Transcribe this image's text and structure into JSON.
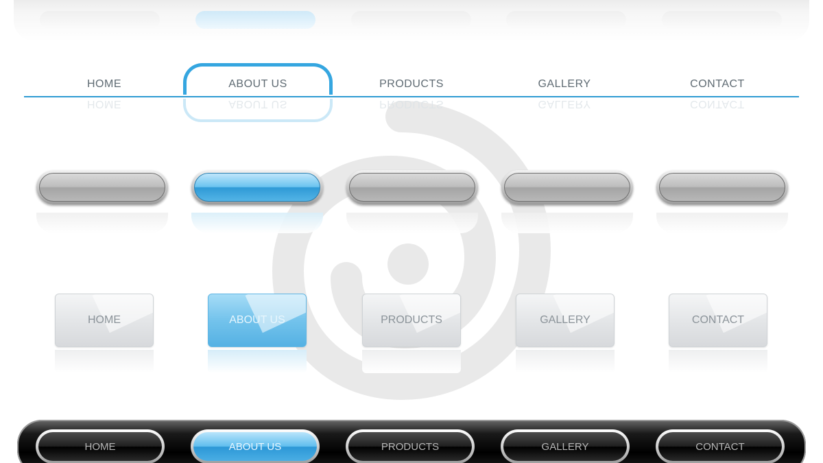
{
  "menu_items": [
    "HOME",
    "ABOUT US",
    "PRODUCTS",
    "GALLERY",
    "CONTACT"
  ],
  "active_item": "ABOUT US",
  "rows": {
    "text_menu": {
      "items": [
        "HOME",
        "ABOUT US",
        "PRODUCTS",
        "GALLERY",
        "CONTACT"
      ]
    },
    "square_buttons": {
      "items": [
        "HOME",
        "ABOUT US",
        "PRODUCTS",
        "GALLERY",
        "CONTACT"
      ]
    },
    "dark_bar": {
      "items": [
        "HOME",
        "ABOUT US",
        "PRODUCTS",
        "GALLERY",
        "CONTACT"
      ]
    }
  },
  "colors": {
    "accent_blue": "#35a6e0",
    "line_blue": "#2d9ad2",
    "text_gray": "#5e6a72",
    "dark_bar": "#000000"
  }
}
